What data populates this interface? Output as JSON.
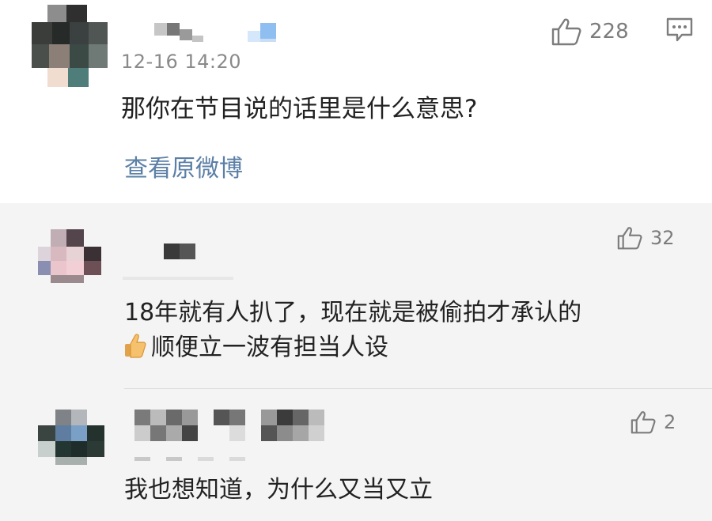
{
  "main_comment": {
    "timestamp": "12-16 14:20",
    "text": "那你在节目说的话里是什么意思?",
    "like_count": "228",
    "view_original_label": "查看原微博"
  },
  "replies": [
    {
      "like_count": "32",
      "text_line1": "18年就有人扒了，现在就是被偷拍才承认的",
      "text_line2": "顺便立一波有担当人设",
      "emoji": "👍"
    },
    {
      "like_count": "2",
      "text": "我也想知道，为什么又当又立"
    }
  ],
  "icons": {
    "like": "thumbs-up-outline-icon",
    "message": "message-bubble-icon",
    "emoji": "thumbs-up-emoji-icon"
  },
  "colors": {
    "link": "#5b7fa6",
    "muted": "#8a8a8a",
    "reply_background": "#f4f4f4"
  }
}
